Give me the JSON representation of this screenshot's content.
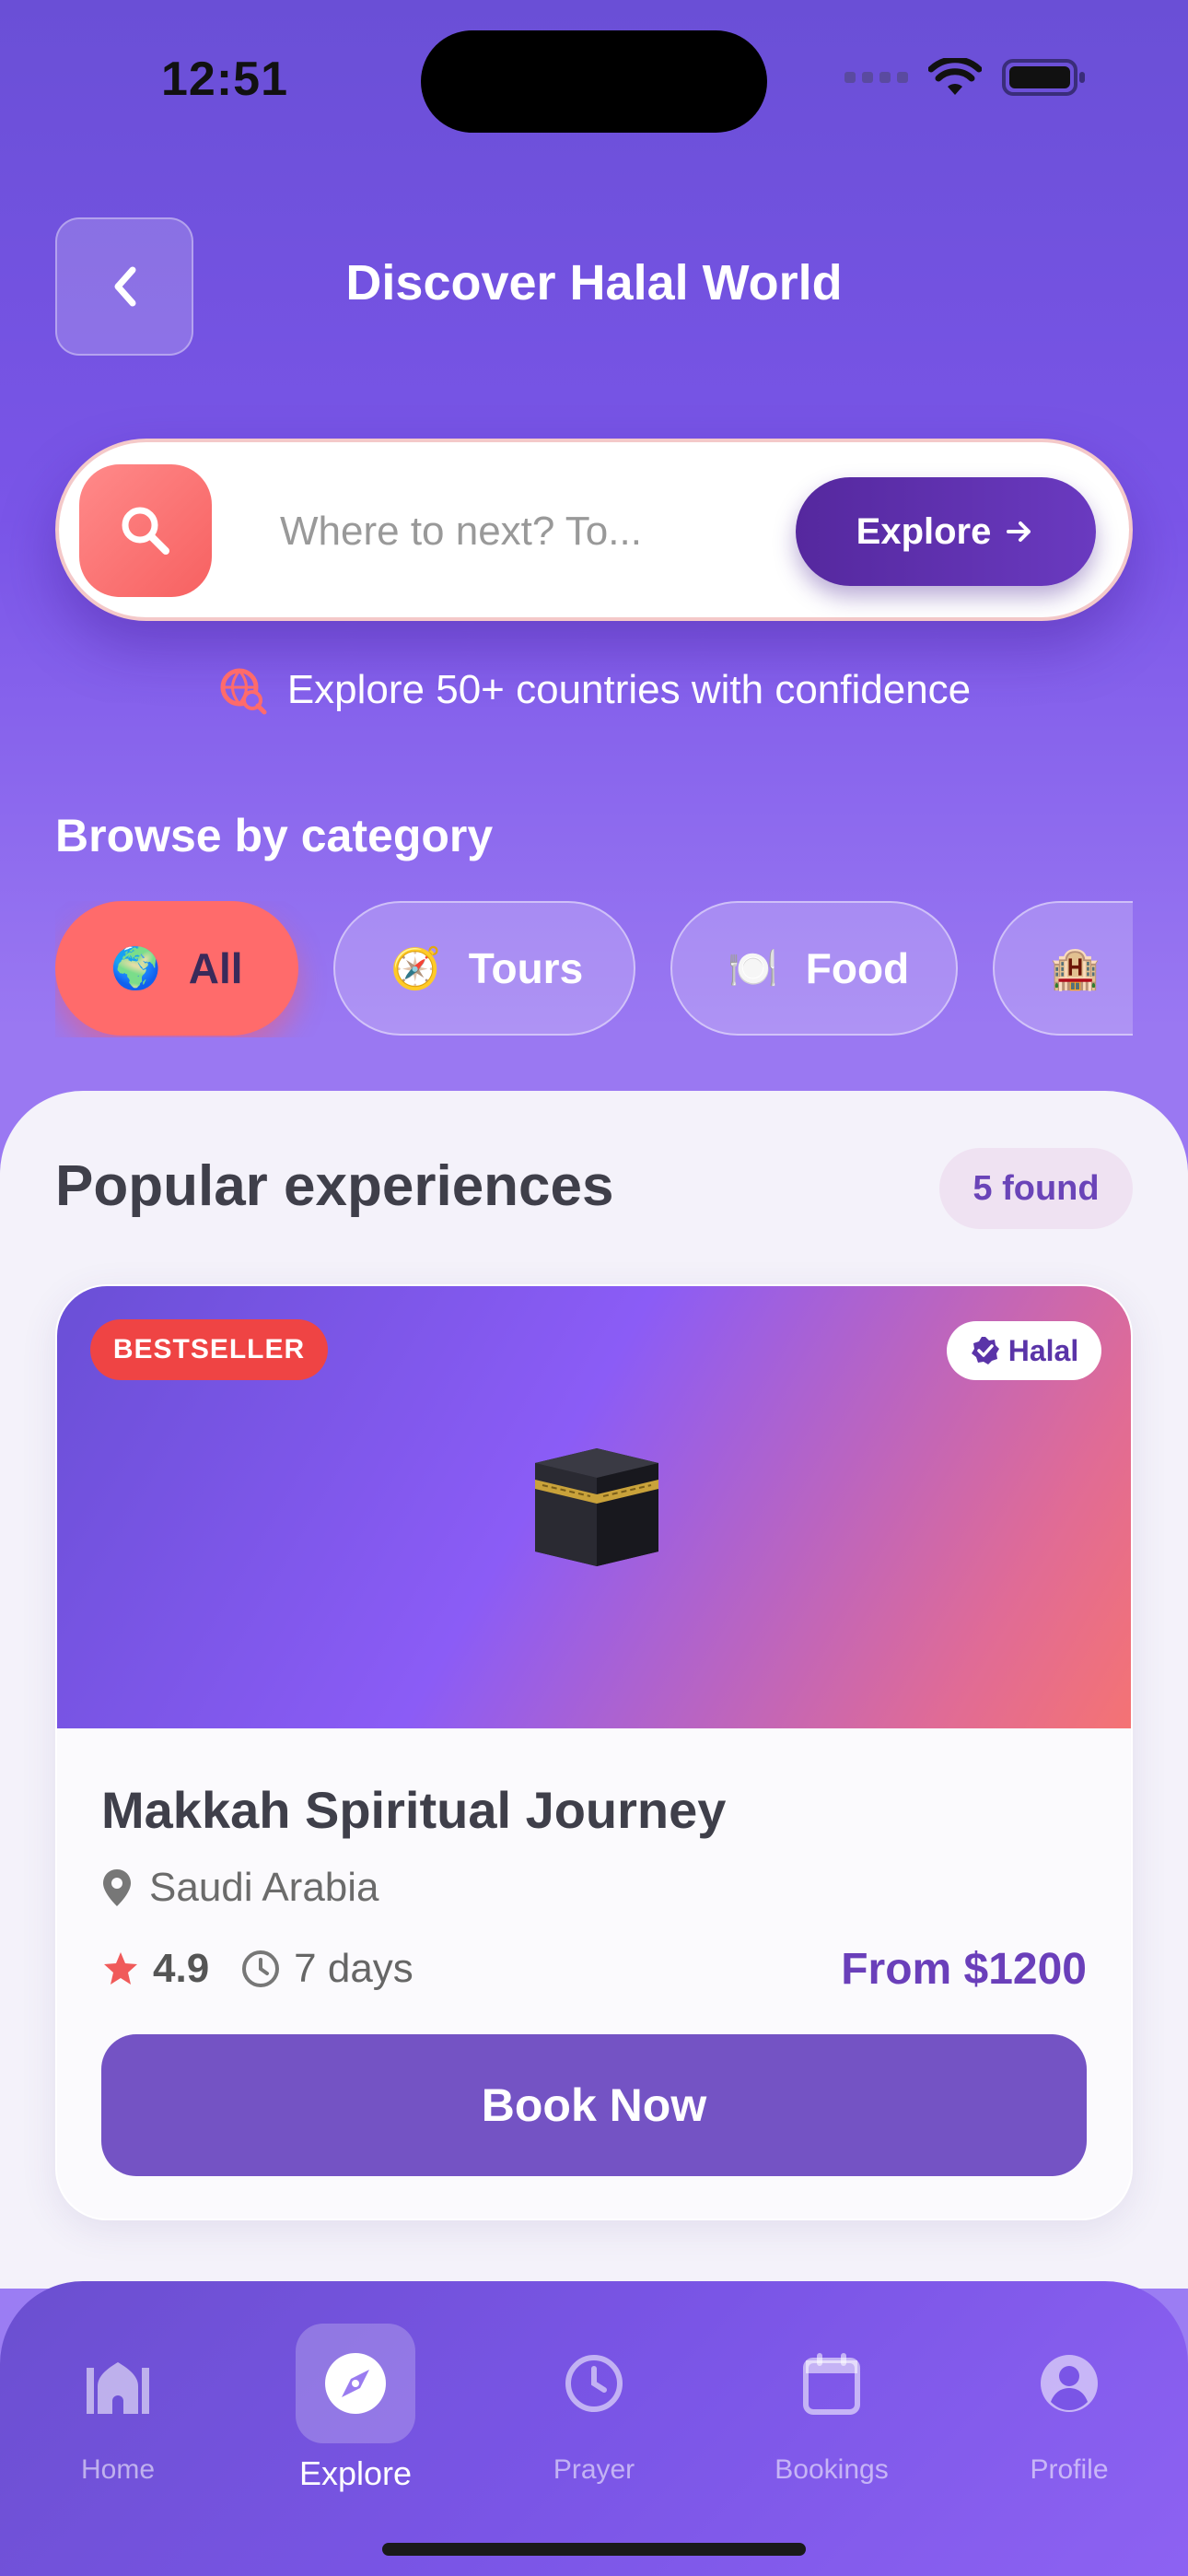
{
  "status": {
    "time": "12:51"
  },
  "header": {
    "title": "Discover Halal World"
  },
  "search": {
    "placeholder": "Where to next? To...",
    "button_label": "Explore"
  },
  "hint": {
    "text": "Explore 50+ countries with confidence"
  },
  "categories": {
    "label": "Browse by category",
    "items": [
      {
        "emoji": "🌍",
        "label": "All",
        "active": true
      },
      {
        "emoji": "🧭",
        "label": "Tours",
        "active": false
      },
      {
        "emoji": "🍽️",
        "label": "Food",
        "active": false
      },
      {
        "emoji": "🏨",
        "label": "",
        "active": false
      }
    ]
  },
  "popular": {
    "title": "Popular experiences",
    "count_label": "5 found",
    "card": {
      "badge": "BESTSELLER",
      "halal_label": "Halal",
      "title": "Makkah Spiritual Journey",
      "location": "Saudi Arabia",
      "rating": "4.9",
      "duration": "7 days",
      "price": "From $1200",
      "book_label": "Book Now"
    }
  },
  "nav": {
    "items": [
      {
        "label": "Home",
        "icon": "mosque-icon",
        "active": false
      },
      {
        "label": "Explore",
        "icon": "compass-icon",
        "active": true
      },
      {
        "label": "Prayer",
        "icon": "clock-icon",
        "active": false
      },
      {
        "label": "Bookings",
        "icon": "calendar-icon",
        "active": false
      },
      {
        "label": "Profile",
        "icon": "profile-icon",
        "active": false
      }
    ]
  },
  "colors": {
    "accent": "#ff6b6b",
    "primary": "#7453c4",
    "price": "#6a3fba"
  }
}
